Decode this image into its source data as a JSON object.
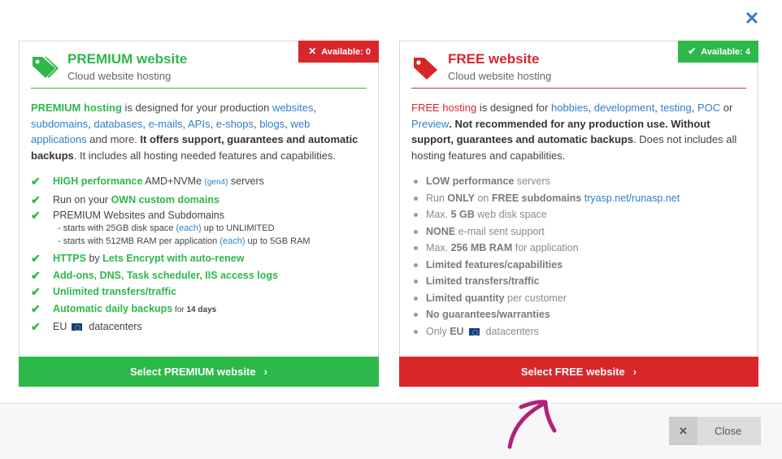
{
  "dialog": {
    "close_glyph": "✕"
  },
  "premium": {
    "badge": {
      "glyph": "✕",
      "label": "Available: 0"
    },
    "title": "PREMIUM website",
    "subtitle": "Cloud website hosting",
    "desc": {
      "lead": "PREMIUM hosting",
      "t1": " is designed for your production ",
      "links1": [
        "websites",
        "subdomains",
        "databases",
        "e-mails",
        "APIs",
        "e-shops",
        "blogs",
        "web applications"
      ],
      "t2": " and more. ",
      "bold": "It offers support, guarantees and automatic backups",
      "t3": ". It includes all hosting needed features and capabilities."
    },
    "features": {
      "f1": {
        "a": "HIGH performance",
        "b": " AMD+NVMe ",
        "c": "(gen4)",
        "d": " servers"
      },
      "f2": {
        "a": "Run on your ",
        "b": "OWN custom domains"
      },
      "f3": {
        "title": "PREMIUM Websites and Subdomains",
        "sub1": {
          "a": "- starts with 25GB disk space ",
          "b": "(each)",
          "c": " up to UNLIMITED"
        },
        "sub2": {
          "a": "- starts with 512MB RAM per application ",
          "b": "(each)",
          "c": " up to 5GB RAM"
        }
      },
      "f4": {
        "a": "HTTPS",
        "b": " by ",
        "c": "Lets Encrypt with auto-renew"
      },
      "f5": "Add-ons, DNS, Task scheduler, IIS access logs",
      "f6": "Unlimited transfers/traffic",
      "f7": {
        "a": "Automatic daily backups",
        "b": " for ",
        "c": "14 days"
      },
      "f8": {
        "a": "EU",
        "b": "datacenters"
      }
    },
    "button": {
      "label": "Select PREMIUM website",
      "chevron": "›"
    }
  },
  "free": {
    "badge": {
      "glyph": "✔",
      "label": "Available: 4"
    },
    "title": "FREE website",
    "subtitle": "Cloud website hosting",
    "desc": {
      "lead": "FREE hosting",
      "t1": " is designed for ",
      "links1": [
        "hobbies",
        "development",
        "testing",
        "POC"
      ],
      "or": " or ",
      "link2": "Preview",
      "bold": ". Not recommended for any production use. Without support, guarantees and automatic backups",
      "t3": ". Does not includes all hosting features and capabilities."
    },
    "features": {
      "f1": {
        "a": "LOW performance",
        "b": " servers"
      },
      "f2": {
        "a": "Run ",
        "b": "ONLY",
        "c": " on ",
        "d": "FREE subdomains",
        "e": " tryasp.net/runasp.net"
      },
      "f3": {
        "a": "Max. ",
        "b": "5 GB",
        "c": " web disk space"
      },
      "f4": {
        "a": "NONE",
        "b": " e-mail sent support"
      },
      "f5": {
        "a": "Max. ",
        "b": "256 MB RAM",
        "c": " for application"
      },
      "f6": "Limited features/capabilities",
      "f7": "Limited transfers/traffic",
      "f8": {
        "a": "Limited quantity",
        "b": " per customer"
      },
      "f9": "No guarantees/warranties",
      "f10": {
        "a": "Only ",
        "b": "EU",
        "c": "datacenters"
      }
    },
    "button": {
      "label": "Select FREE website",
      "chevron": "›"
    }
  },
  "footer": {
    "close_glyph": "✕",
    "close_label": "Close"
  },
  "colors": {
    "green": "#2db84a",
    "red": "#d9262b",
    "link": "#2f7fc8",
    "annotation": "#b0217a"
  }
}
